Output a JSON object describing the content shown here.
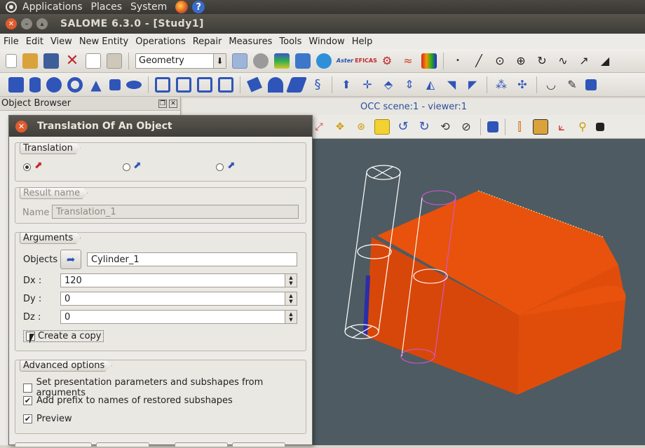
{
  "gnome_panel": {
    "menus": [
      "Applications",
      "Places",
      "System"
    ]
  },
  "window": {
    "title": "SALOME 6.3.0 - [Study1]"
  },
  "menubar": {
    "items": [
      "File",
      "Edit",
      "View",
      "New Entity",
      "Operations",
      "Repair",
      "Measures",
      "Tools",
      "Window",
      "Help"
    ]
  },
  "toolbar": {
    "module_combo_value": "Geometry"
  },
  "object_browser": {
    "title": "Object Browser"
  },
  "viewer": {
    "tab_label": "OCC scene:1 - viewer:1",
    "background_color": "#4e5b62",
    "box_color": "#e8520c"
  },
  "dialog": {
    "title": "Translation Of An Object",
    "translation_group": {
      "title": "Translation",
      "selected_option_index": 0
    },
    "result_group": {
      "title": "Result name",
      "name_label": "Name",
      "name_value": "Translation_1"
    },
    "arguments_group": {
      "title": "Arguments",
      "objects_label": "Objects",
      "objects_value": "Cylinder_1",
      "dx_label": "Dx :",
      "dx_value": "120",
      "dy_label": "Dy :",
      "dy_value": "0",
      "dz_label": "Dz :",
      "dz_value": "0",
      "create_copy_label": "Create a copy",
      "create_copy_checked": false
    },
    "advanced_group": {
      "title": "Advanced options",
      "set_presentation_label": "Set presentation parameters and subshapes from arguments",
      "set_presentation_checked": false,
      "add_prefix_label": "Add prefix to names of restored subshapes",
      "add_prefix_checked": true,
      "preview_label": "Preview",
      "preview_checked": true
    }
  }
}
